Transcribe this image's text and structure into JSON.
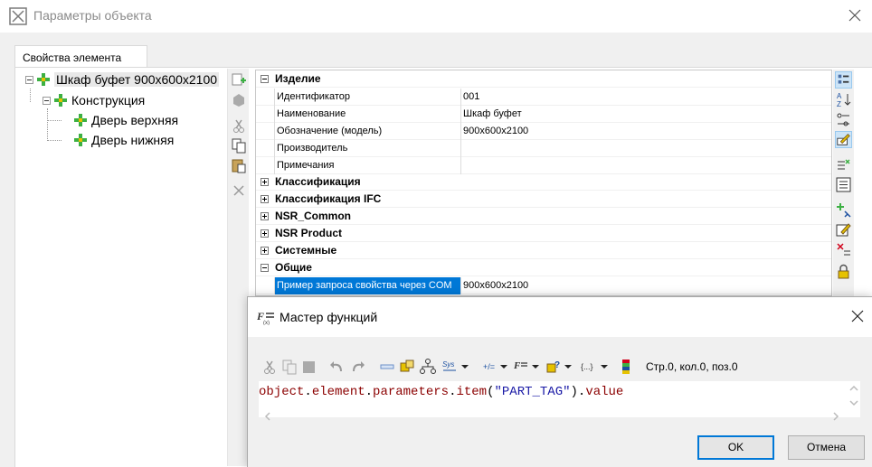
{
  "window": {
    "title": "Параметры объекта"
  },
  "tab": {
    "label": "Свойства элемента"
  },
  "tree": {
    "root": "Шкаф буфет 900x600x2100",
    "child": "Конструкция",
    "leaves": [
      "Дверь верхняя",
      "Дверь нижняя"
    ]
  },
  "props": {
    "cat_izdelie": "Изделие",
    "rows": [
      {
        "name": "Идентификатор",
        "value": "001"
      },
      {
        "name": "Наименование",
        "value": "Шкаф буфет"
      },
      {
        "name": "Обозначение (модель)",
        "value": "900x600x2100"
      },
      {
        "name": "Производитель",
        "value": ""
      },
      {
        "name": "Примечания",
        "value": ""
      }
    ],
    "categories": [
      "Классификация",
      "Классификация IFC",
      "NSR_Common",
      "NSR Product",
      "Системные"
    ],
    "cat_obshie": "Общие",
    "selected_row": {
      "name": "Пример запроса свойства через COM",
      "value": "900x600x2100"
    }
  },
  "dialog": {
    "title": "Мастер функций",
    "status": "Стр.0, кол.0, поз.0",
    "code": {
      "p1": "object",
      "p2": ".",
      "p3": "element",
      "p4": ".",
      "p5": "parameters",
      "p6": ".",
      "p7": "item",
      "p8": "(",
      "p9": "\"PART_TAG\"",
      "p10": ").",
      "p11": "value"
    },
    "ok": "OK",
    "cancel": "Отмена"
  },
  "colors": {
    "accent": "#0078d7",
    "node_green": "#3cb043",
    "node_yellow": "#e6c200"
  }
}
